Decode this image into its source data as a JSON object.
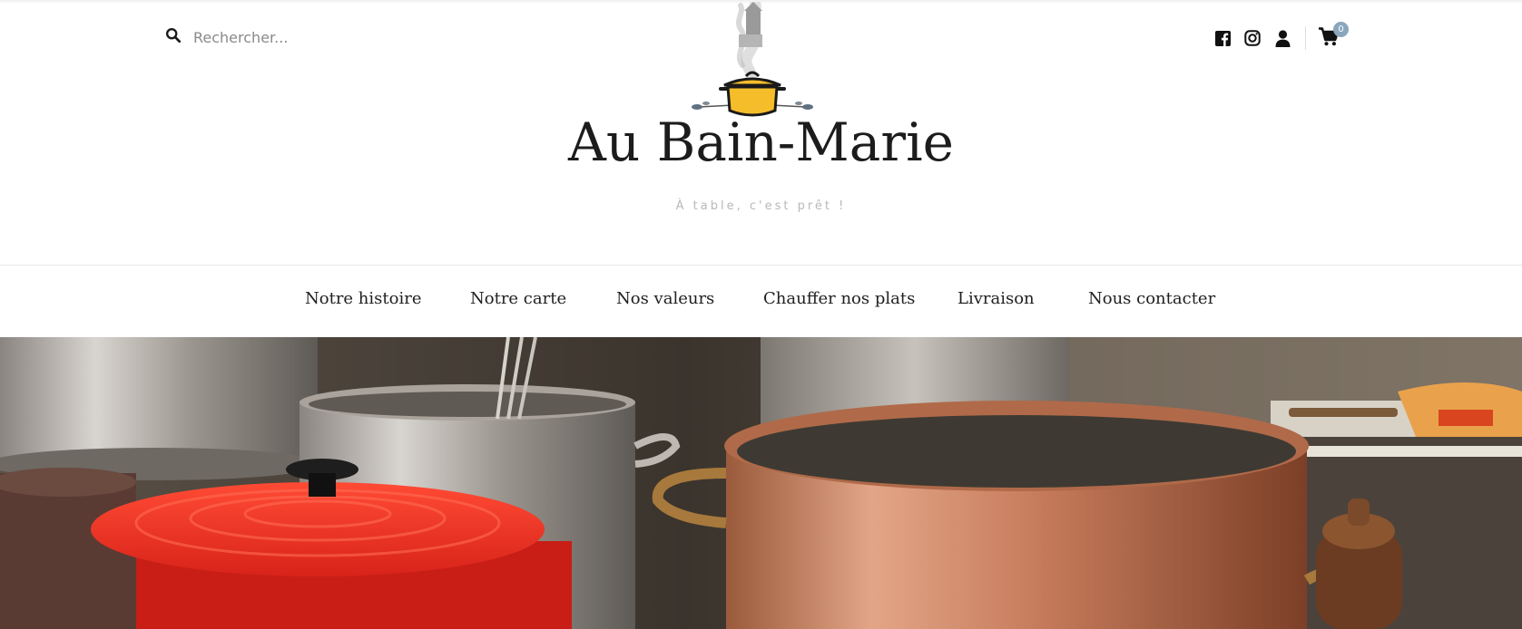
{
  "search": {
    "placeholder": "Rechercher..."
  },
  "brand": {
    "title": "Au Bain-Marie",
    "tagline": "À table, c'est prêt !",
    "accent": "#f6bd2b"
  },
  "header_icons": [
    {
      "icon": "facebook-icon"
    },
    {
      "icon": "instagram-icon"
    },
    {
      "icon": "user-icon"
    },
    {
      "icon": "cart-icon",
      "badge": "0",
      "badge_color": "#8aa6bd"
    }
  ],
  "nav": {
    "items": [
      {
        "label": "Notre histoire"
      },
      {
        "label": "Notre carte"
      },
      {
        "label": "Nos valeurs"
      },
      {
        "label": "Chauffer nos plats"
      },
      {
        "label": "Livraison"
      },
      {
        "label": "Nous contacter"
      }
    ]
  },
  "hero": {
    "image": "kitchen-pots-photo"
  }
}
